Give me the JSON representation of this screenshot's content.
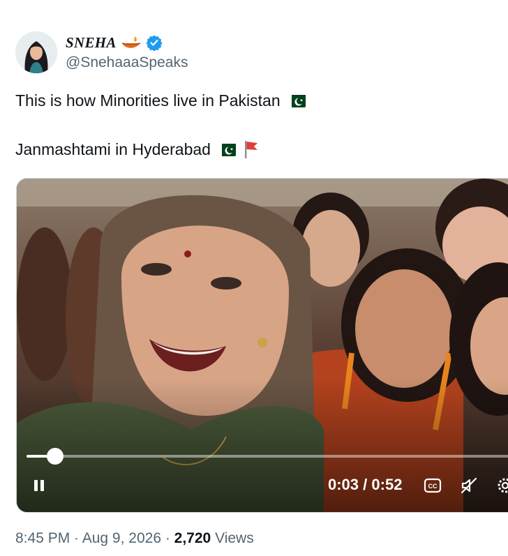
{
  "author": {
    "display_name": "SNEHA",
    "handle": "@SnehaaaSpeaks",
    "verified": true
  },
  "tweet": {
    "line1": "This is how Minorities live in Pakistan",
    "line2": "Janmashtami in Hyderabad"
  },
  "video": {
    "current_time": "0:03",
    "time_separator": " / ",
    "duration": "0:52",
    "progress_fraction": 0.058,
    "icons": [
      "pause-icon",
      "captions-icon",
      "muted-speaker-icon",
      "settings-gear-icon"
    ]
  },
  "meta": {
    "time": "8:45 PM",
    "sep1": " · ",
    "date": "Aug 9, 2026",
    "sep2": " · ",
    "views_count": "2,720",
    "views_label": " Views"
  },
  "colors": {
    "text": "#0f1419",
    "secondary": "#536471",
    "verified": "#1d9bf0",
    "pk_green": "#01411c"
  }
}
